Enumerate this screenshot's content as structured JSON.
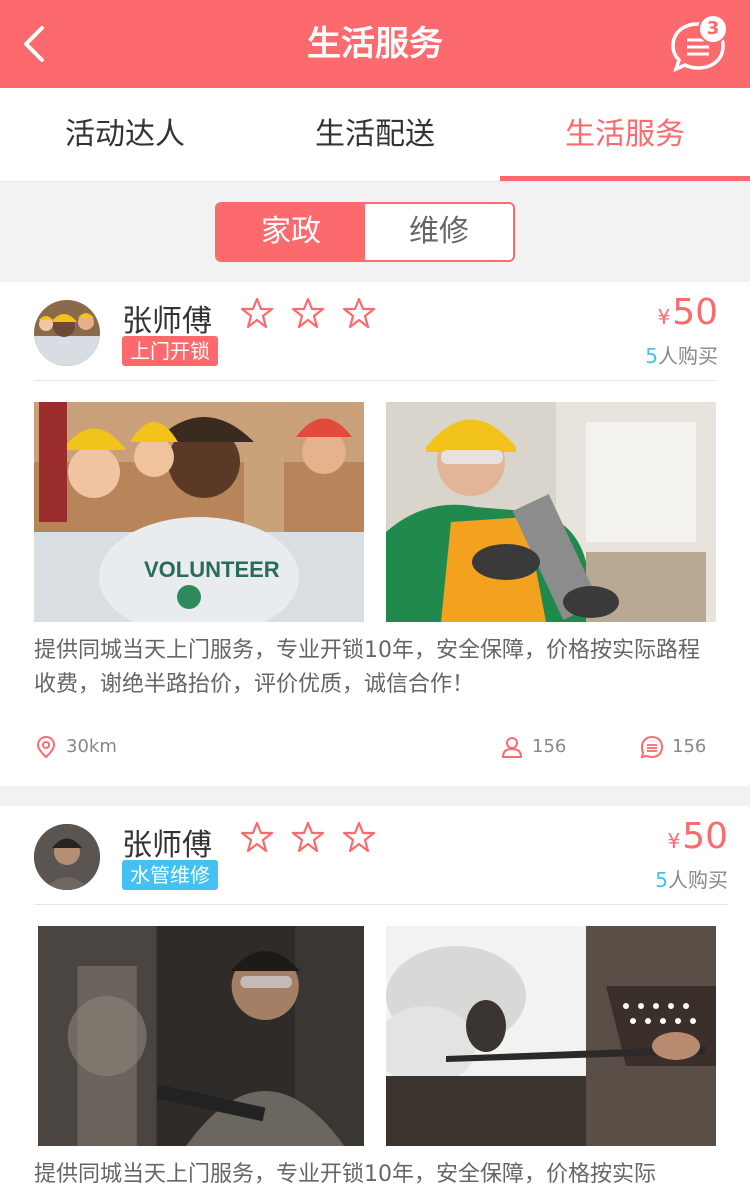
{
  "header": {
    "title": "生活服务",
    "message_badge": "3",
    "back_icon": "chevron-left-icon",
    "message_icon": "message-icon"
  },
  "tabs": [
    {
      "label": "活动达人"
    },
    {
      "label": "生活配送"
    },
    {
      "label": "生活服务",
      "active": true
    }
  ],
  "segment": {
    "options": [
      "家政",
      "维修"
    ],
    "selected": "家政"
  },
  "colors": {
    "accent": "#fc6a6e",
    "blue": "#44c1f0"
  },
  "cards": [
    {
      "name": "张师傅",
      "rating": 3,
      "tag": "上门开锁",
      "price_symbol": "¥",
      "price": "50",
      "buyer_count": "5",
      "buyer_suffix": "人购买",
      "description": "提供同城当天上门服务，专业开锁10年，安全保障，价格按实际路程收费，谢绝半路抬价，评价优质，诚信合作！",
      "distance": "30km",
      "likes": "156",
      "comments": "156"
    },
    {
      "name": "张师傅",
      "rating": 3,
      "tag": "水管维修",
      "price_symbol": "¥",
      "price": "50",
      "buyer_count": "5",
      "buyer_suffix": "人购买",
      "description": "提供同城当天上门服务，专业开锁10年，安全保障，价格按实际"
    }
  ]
}
